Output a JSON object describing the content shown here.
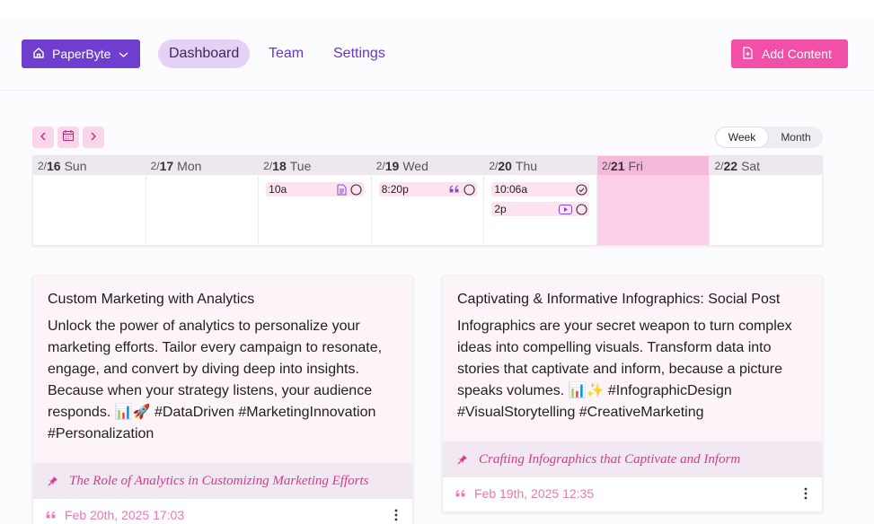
{
  "nav": {
    "brand_label": "PaperByte",
    "links": [
      {
        "label": "Dashboard",
        "active": true
      },
      {
        "label": "Team",
        "active": false
      },
      {
        "label": "Settings",
        "active": false
      }
    ],
    "add_label": "Add Content"
  },
  "calendar": {
    "view_options": [
      "Week",
      "Month"
    ],
    "selected_view": "Week",
    "days": [
      {
        "month": "2/",
        "num": "16",
        "name": "Sun",
        "today": false,
        "events": []
      },
      {
        "month": "2/",
        "num": "17",
        "name": "Mon",
        "today": false,
        "events": []
      },
      {
        "month": "2/",
        "num": "18",
        "name": "Tue",
        "today": false,
        "events": [
          {
            "time": "10a",
            "type": "document-icon",
            "status": "circle-icon"
          }
        ]
      },
      {
        "month": "2/",
        "num": "19",
        "name": "Wed",
        "today": false,
        "events": [
          {
            "time": "8:20p",
            "type": "quote-icon",
            "status": "circle-icon"
          }
        ]
      },
      {
        "month": "2/",
        "num": "20",
        "name": "Thu",
        "today": false,
        "events": [
          {
            "time": "10:06a",
            "type": "",
            "status": "check-circle-icon"
          },
          {
            "time": "2p",
            "type": "video-icon",
            "status": "circle-icon"
          }
        ]
      },
      {
        "month": "2/",
        "num": "21",
        "name": "Fri",
        "today": true,
        "events": []
      },
      {
        "month": "2/",
        "num": "22",
        "name": "Sat",
        "today": false,
        "events": []
      }
    ]
  },
  "cards": [
    {
      "title": "Custom Marketing with Analytics",
      "text": "Unlock the power of analytics to personalize your marketing efforts. Tailor every campaign to resonate, engage, and convert by diving deep into insights. Because when your strategy listens, your audience responds. 📊🚀 #DataDriven #MarketingInnovation #Personalization",
      "topic": "The Role of Analytics in Customizing Marketing Efforts",
      "timestamp": "Feb 20th, 2025 17:03"
    },
    {
      "title": "Captivating & Informative Infographics: Social Post",
      "text": "Infographics are your secret weapon to turn complex ideas into compelling visuals. Transform data into stories that captivate and inform, because a picture speaks volumes. 📊✨ #InfographicDesign #VisualStorytelling #CreativeMarketing",
      "topic": "Crafting Infographics that Captivate and Inform",
      "timestamp": "Feb 19th, 2025 12:35"
    }
  ],
  "colors": {
    "brand": "#6f3ecf",
    "accent": "#f24fa8",
    "today": "#fbcfe8"
  }
}
